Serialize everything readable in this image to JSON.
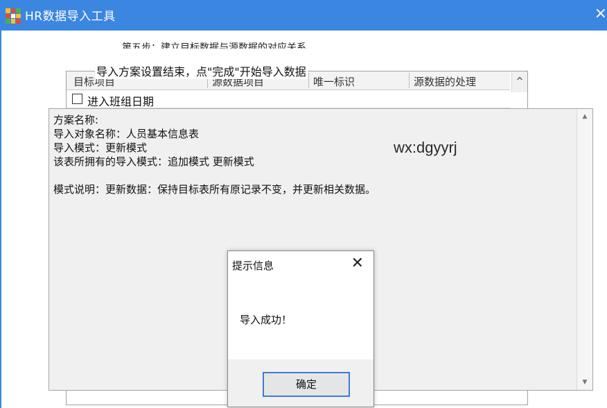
{
  "window": {
    "title": "HR数据导入工具",
    "close_glyph": "×",
    "colors": {
      "titlebar": "#3b86e0",
      "ok_border": "#3b7bd4"
    }
  },
  "wizard": {
    "step_text": "第五步：建立目标数据与源数据的对应关系",
    "sub_text": "导入方案设置结束，点\"完成\"开始导入数据"
  },
  "grid": {
    "columns": [
      "目标项目",
      "源数据项目",
      "唯一标识",
      "源数据的处理"
    ],
    "rows": [
      {
        "label": "进入班组日期",
        "checked": false
      }
    ]
  },
  "info": {
    "lines": [
      "方案名称:",
      "导入对象名称：人员基本信息表",
      "导入模式：更新模式",
      "该表所拥有的导入模式：追加模式 更新模式",
      "",
      "模式说明：更新数据：保持目标表所有原记录不变，并更新相关数据。"
    ],
    "watermark": "wx:dgyyrj"
  },
  "dialog": {
    "title": "提示信息",
    "close_glyph": "✕",
    "message": "导入成功！",
    "ok_label": "确定"
  },
  "icons": {
    "app": "app-grid-icon",
    "scroll_up": "▲",
    "scroll_down": "▼",
    "grid_scroll_up": "^"
  }
}
